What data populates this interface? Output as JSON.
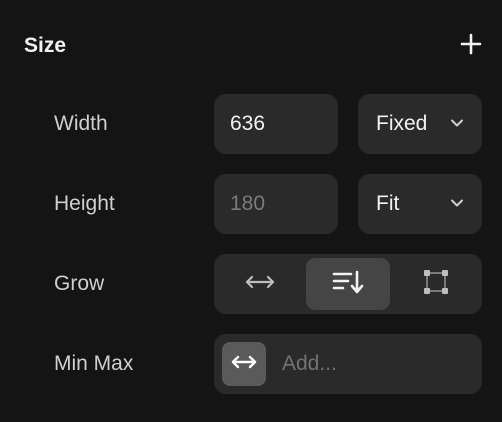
{
  "section": {
    "title": "Size",
    "add_icon": "plus-icon"
  },
  "width": {
    "label": "Width",
    "value": "636",
    "mode": "Fixed",
    "mode_icon": "chevron-down-icon"
  },
  "height": {
    "label": "Height",
    "value": "180",
    "mode": "Fit",
    "mode_icon": "chevron-down-icon"
  },
  "grow": {
    "label": "Grow",
    "options": [
      {
        "icon": "horizontal-arrows-icon",
        "active": false
      },
      {
        "icon": "stack-down-icon",
        "active": true
      },
      {
        "icon": "frame-corners-icon",
        "active": false
      }
    ]
  },
  "minmax": {
    "label": "Min Max",
    "icon": "horizontal-arrows-icon",
    "placeholder": "Add..."
  },
  "colors": {
    "background": "#141414",
    "field": "#2a2a2a",
    "active_segment": "#454545",
    "icon_box": "#5a5a5a"
  }
}
